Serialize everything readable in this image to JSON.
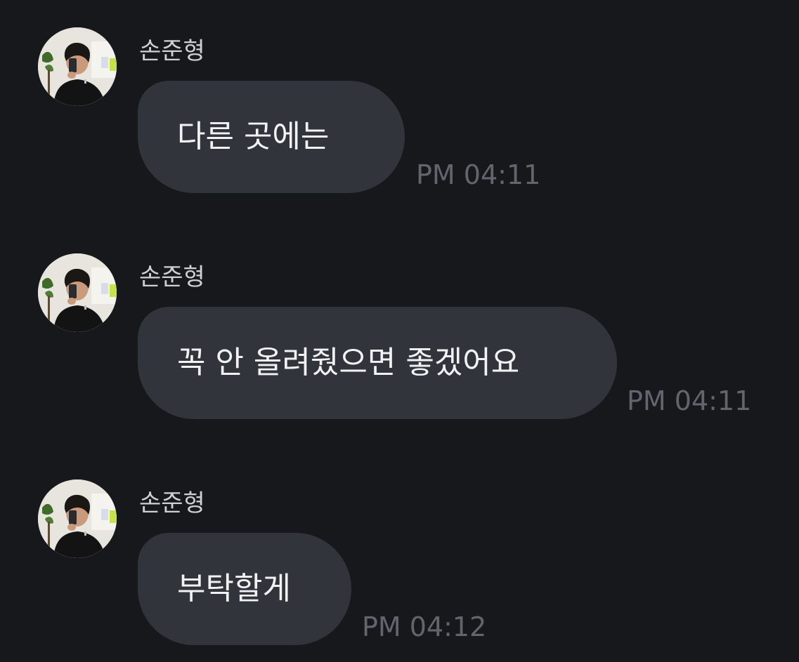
{
  "colors": {
    "background": "#17181c",
    "bubble": "#31343b",
    "name_text": "#cfd0d4",
    "message_text": "#f2f2f4",
    "timestamp_text": "#62656d"
  },
  "messages": [
    {
      "sender": "손준형",
      "text": "다른 곳에는",
      "time": "PM 04:11",
      "avatar_icon": "profile-photo"
    },
    {
      "sender": "손준형",
      "text": "꼭 안 올려줬으면 좋겠어요",
      "time": "PM 04:11",
      "avatar_icon": "profile-photo"
    },
    {
      "sender": "손준형",
      "text": "부탁할게",
      "time": "PM 04:12",
      "avatar_icon": "profile-photo"
    }
  ]
}
